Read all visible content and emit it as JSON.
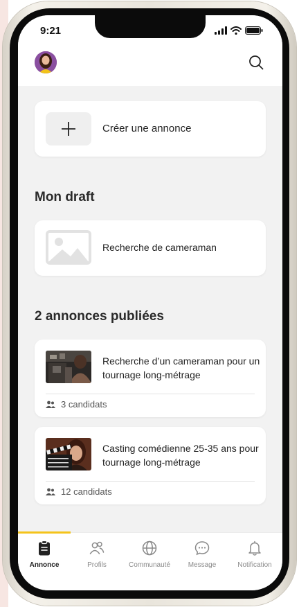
{
  "status_bar": {
    "time": "9:21"
  },
  "header": {
    "avatar_icon": "user-avatar",
    "search_icon": "search-icon"
  },
  "create": {
    "label": "Créer une annonce",
    "icon": "plus-icon"
  },
  "draft": {
    "section_title": "Mon draft",
    "item": {
      "label": "Recherche de cameraman",
      "icon": "image-placeholder-icon"
    }
  },
  "published": {
    "section_title": "2 annonces publiées",
    "items": [
      {
        "title": "Recherche d’un cameraman pour un tournage long-métrage",
        "candidates": "3 candidats"
      },
      {
        "title": "Casting comédienne 25-35 ans pour tournage long-métrage",
        "candidates": "12 candidats"
      }
    ]
  },
  "tabs": [
    {
      "label": "Annonce",
      "icon": "clipboard-icon",
      "active": true
    },
    {
      "label": "Profils",
      "icon": "users-icon",
      "active": false
    },
    {
      "label": "Communauté",
      "icon": "globe-icon",
      "active": false
    },
    {
      "label": "Message",
      "icon": "chat-icon",
      "active": false
    },
    {
      "label": "Notification",
      "icon": "bell-icon",
      "active": false
    }
  ],
  "colors": {
    "accent": "#f4c31b",
    "background": "#f2f2f2",
    "card": "#ffffff"
  }
}
